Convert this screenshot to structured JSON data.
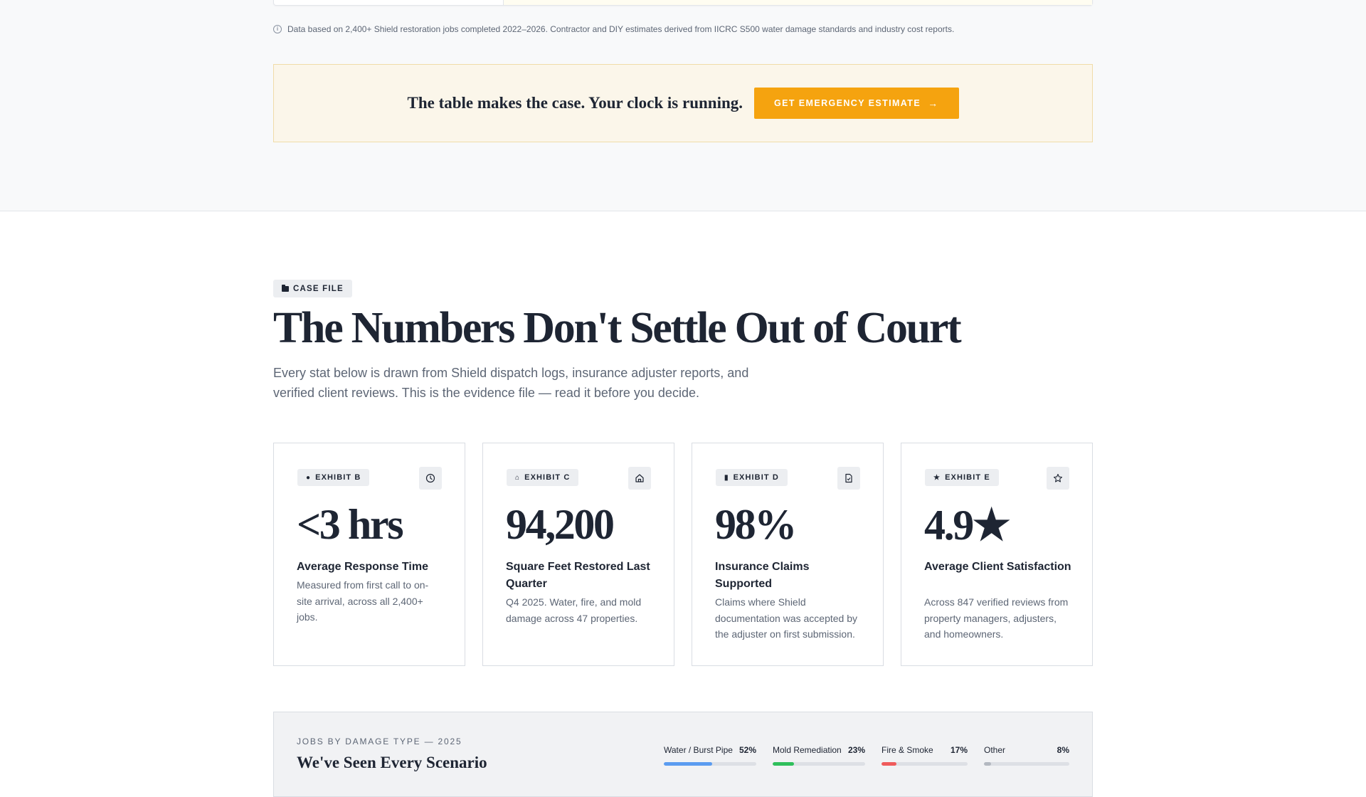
{
  "source_note": "Data based on 2,400+ Shield restoration jobs completed 2022–2026. Contractor and DIY estimates derived from IICRC S500 water damage standards and industry cost reports.",
  "cta": {
    "text": "The table makes the case. Your clock is running.",
    "button_label": "GET EMERGENCY ESTIMATE",
    "button_arrow": "→"
  },
  "section": {
    "tag": "CASE FILE",
    "headline": "The Numbers Don't Settle Out of Court",
    "subhead": "Every stat below is drawn from Shield dispatch logs, insurance adjuster reports, and verified client reviews. This is the evidence file — read it before you decide."
  },
  "cards": [
    {
      "exhibit": "EXHIBIT B",
      "glyph": "●",
      "icon": "clock-icon",
      "value": "<3 hrs",
      "label": "Average Response Time",
      "desc": "Measured from first call to on-site arrival, across all 2,400+ jobs."
    },
    {
      "exhibit": "EXHIBIT C",
      "glyph": "⌂",
      "icon": "home-icon",
      "value": "94,200",
      "label": "Square Feet Restored Last Quarter",
      "desc": "Q4 2025. Water, fire, and mold damage across 47 properties."
    },
    {
      "exhibit": "EXHIBIT D",
      "glyph": "▮",
      "icon": "document-icon",
      "value": "98%",
      "label": "Insurance Claims Supported",
      "desc": "Claims where Shield documentation was accepted by the adjuster on first submission."
    },
    {
      "exhibit": "EXHIBIT E",
      "glyph": "★",
      "icon": "star-icon",
      "value": "4.9★",
      "label": "Average Client Satisfaction",
      "desc": "Across 847 verified reviews from property managers, adjusters, and homeowners."
    }
  ],
  "damage": {
    "eyebrow": "JOBS BY DAMAGE TYPE — 2025",
    "title": "We've Seen Every Scenario",
    "items": [
      {
        "label": "Water / Burst Pipe",
        "pct": "52%",
        "fraction": 0.52,
        "color": "#5b9cf0"
      },
      {
        "label": "Mold Remediation",
        "pct": "23%",
        "fraction": 0.23,
        "color": "#2fbf5b"
      },
      {
        "label": "Fire & Smoke",
        "pct": "17%",
        "fraction": 0.17,
        "color": "#ef5b5b"
      },
      {
        "label": "Other",
        "pct": "8%",
        "fraction": 0.08,
        "color": "#b3b8c0"
      }
    ]
  }
}
